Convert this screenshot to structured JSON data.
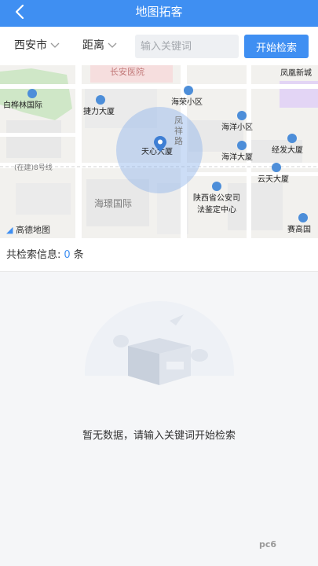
{
  "header": {
    "title": "地图拓客",
    "back_icon": "back-arrow-icon"
  },
  "filters": {
    "city": "西安市",
    "sort": "距离",
    "search_placeholder": "输入关键词",
    "search_value": "",
    "search_button": "开始检索"
  },
  "map": {
    "center_label": "天心大厦",
    "pois": [
      "白桦林国际",
      "捷力大厦",
      "海荣小区",
      "海洋小区",
      "经发大厦",
      "海洋大厦",
      "云天大厦",
      "陕西省公安司",
      "法鉴定中心",
      "赛高国",
      "凤凰新城"
    ],
    "area_labels": [
      "长安医院",
      "凤",
      "祥",
      "路",
      "(在建)8号线",
      "海璟国际"
    ],
    "provider": "高德地图"
  },
  "results": {
    "label": "共检索信息:",
    "count": "0",
    "unit": "条"
  },
  "empty": {
    "message": "暂无数据，请输入关键词开始检索"
  },
  "watermark": "pc6"
}
